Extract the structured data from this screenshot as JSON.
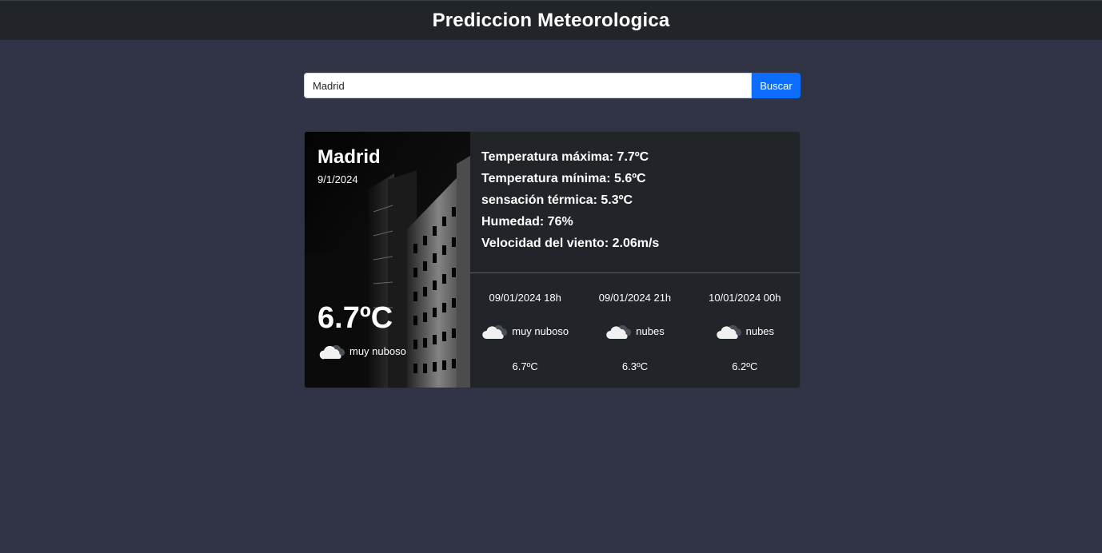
{
  "header": {
    "title": "Prediccion Meteorologica"
  },
  "search": {
    "value": "Madrid",
    "button_label": "Buscar"
  },
  "current": {
    "city": "Madrid",
    "date": "9/1/2024",
    "temperature": "6.7ºC",
    "description": "muy nuboso",
    "icon": "cloudy-icon"
  },
  "details": {
    "max_temp": "Temperatura máxima: 7.7ºC",
    "min_temp": "Temperatura mínima: 5.6ºC",
    "feels_like": "sensación térmica: 5.3ºC",
    "humidity": "Humedad: 76%",
    "wind": "Velocidad del viento: 2.06m/s"
  },
  "forecast": [
    {
      "time": "09/01/2024 18h",
      "description": "muy nuboso",
      "temperature": "6.7ºC",
      "icon": "cloudy-icon"
    },
    {
      "time": "09/01/2024 21h",
      "description": "nubes",
      "temperature": "6.3ºC",
      "icon": "cloudy-icon"
    },
    {
      "time": "10/01/2024 00h",
      "description": "nubes",
      "temperature": "6.2ºC",
      "icon": "cloudy-icon"
    }
  ]
}
